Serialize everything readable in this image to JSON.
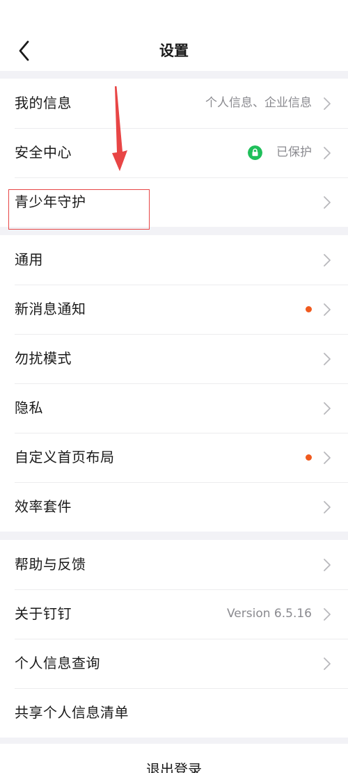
{
  "header": {
    "title": "设置"
  },
  "groups": [
    {
      "rows": [
        {
          "label": "我的信息",
          "value": "个人信息、企业信息"
        },
        {
          "label": "安全中心",
          "value": "已保护"
        },
        {
          "label": "青少年守护",
          "value": ""
        }
      ]
    },
    {
      "rows": [
        {
          "label": "通用",
          "value": ""
        },
        {
          "label": "新消息通知",
          "value": ""
        },
        {
          "label": "勿扰模式",
          "value": ""
        },
        {
          "label": "隐私",
          "value": ""
        },
        {
          "label": "自定义首页布局",
          "value": ""
        },
        {
          "label": "效率套件",
          "value": ""
        }
      ]
    },
    {
      "rows": [
        {
          "label": "帮助与反馈",
          "value": ""
        },
        {
          "label": "关于钉钉",
          "value": "Version 6.5.16"
        },
        {
          "label": "个人信息查询",
          "value": ""
        },
        {
          "label": "共享个人信息清单",
          "value": ""
        }
      ]
    }
  ],
  "footer": {
    "logout_label": "退出登录"
  },
  "icons": {
    "back": "chevron-left-icon",
    "chevron": "chevron-right-icon",
    "lock": "lock-icon",
    "badge": "red-dot-badge"
  },
  "colors": {
    "background": "#f2f2f6",
    "surface": "#ffffff",
    "text_primary": "#1a1a1a",
    "text_secondary": "#8a8a8f",
    "chevron": "#b8b8bc",
    "secure_green": "#1fbf5a",
    "badge_dot": "#f05a1e",
    "annotation_red": "#e84545"
  }
}
